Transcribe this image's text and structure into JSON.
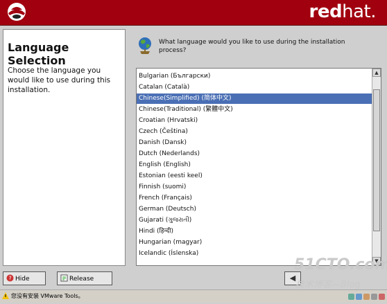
{
  "header": {
    "brand_bold": "red",
    "brand_regular": "hat.",
    "logo_icon": "redhat-shadowman-logo"
  },
  "help": {
    "title": "Language Selection",
    "body": "Choose the language you would like to use during this installation."
  },
  "question": "What language would you like to use during the installation process?",
  "languages": [
    "Bulgarian (Български)",
    "Catalan (Català)",
    "Chinese(Simplified) (简体中文)",
    "Chinese(Traditional) (繁體中文)",
    "Croatian (Hrvatski)",
    "Czech (Čeština)",
    "Danish (Dansk)",
    "Dutch (Nederlands)",
    "English (English)",
    "Estonian (eesti keel)",
    "Finnish (suomi)",
    "French (Français)",
    "German (Deutsch)",
    "Gujarati (ગુજરાતી)",
    "Hindi (हिन्दी)",
    "Hungarian (magyar)",
    "Icelandic (Íslenska)"
  ],
  "selected_language": "Chinese(Simplified) (简体中文)",
  "buttons": {
    "hide_help": "Hide Help",
    "release_notes": "Release Notes",
    "back_icon": "back-arrow-icon"
  },
  "watermark": {
    "site": "51CTO.com",
    "tagline": "技术博客—Blog"
  },
  "statusbar": {
    "text": "您没有安装 VMware Tools。"
  },
  "colors": {
    "header": "#a1000f",
    "selection": "#4a6fb5"
  }
}
